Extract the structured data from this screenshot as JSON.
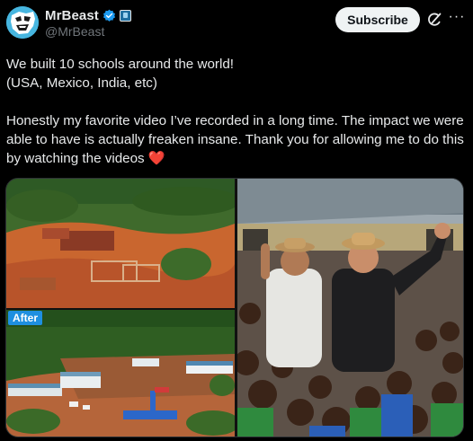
{
  "author": {
    "display_name": "MrBeast",
    "handle": "@MrBeast",
    "avatar_icon": "mrbeast-logo-avatar",
    "verified_icon": "verified-badge-icon",
    "affiliate_icon": "affiliate-badge-icon"
  },
  "actions": {
    "subscribe_label": "Subscribe",
    "grok_icon": "grok-icon",
    "more_icon": "more-options-icon",
    "more_glyph": "···"
  },
  "tweet": {
    "line1": "We built 10 schools around the world!",
    "line2": "(USA, Mexico, India, etc)",
    "para2_a": "Honestly my favorite video I’ve recorded in a long time. The impact we were able to have is actually freaken insane. Thank you for allowing me to do this by watching the videos ",
    "emoji": "❤️"
  },
  "media": {
    "before_after_label": "After",
    "left_image": "aerial-school-construction-before-after",
    "right_image": "mrbeast-with-children-at-school"
  },
  "colors": {
    "accent_blue": "#1d9bf0",
    "background": "#000000",
    "text_primary": "#e7e9ea",
    "text_secondary": "#71767b",
    "heart": "#f91880",
    "after_label": "#1e8fe0"
  }
}
